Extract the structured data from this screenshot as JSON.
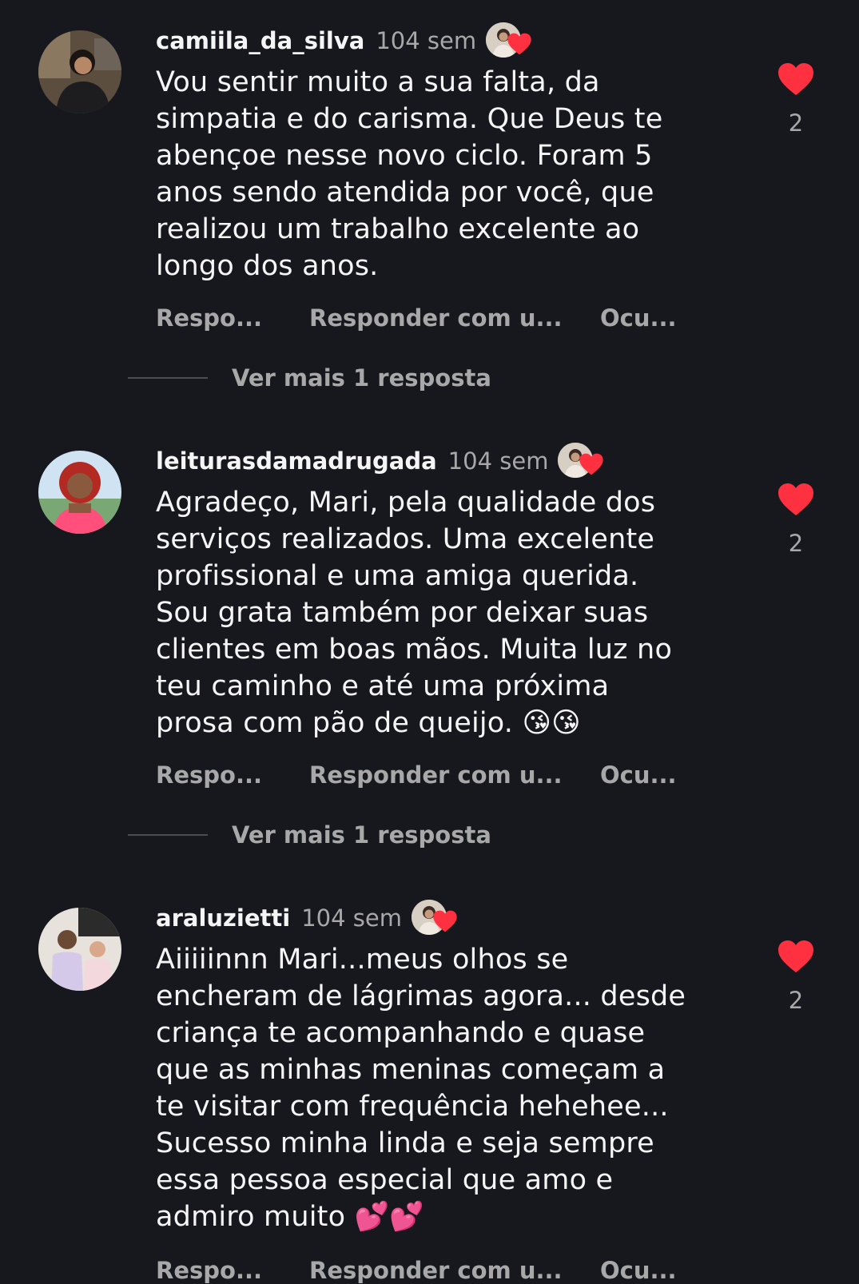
{
  "colors": {
    "background": "#16181d",
    "heart": "#ff3040",
    "muted_text": "#a8a8a8"
  },
  "actions": {
    "reply": "Respo...",
    "reply_sticker": "Responder com u...",
    "hide": "Ocu..."
  },
  "comments": [
    {
      "username": "camiila_da_silva",
      "time": "104 sem",
      "text": "Vou sentir muito a sua falta, da\nsimpatia e do carisma. Que Deus te\nabençoe nesse novo ciclo. Foram 5\nanos sendo atendida por você, que\nrealizou um trabalho excelente ao\nlongo dos anos.",
      "likes": "2",
      "liked_by_author": true,
      "more_replies": "Ver mais 1 resposta",
      "avatar_icon": "user-photo-icon"
    },
    {
      "username": "leiturasdamadrugada",
      "time": "104 sem",
      "text": "Agradeço, Mari, pela qualidade dos\nserviços realizados. Uma excelente\nprofissional e uma amiga querida.\nSou grata também por deixar suas\nclientes em boas mãos. Muita luz no\nteu caminho e até uma próxima\nprosa com pão de queijo. 😘😘",
      "likes": "2",
      "liked_by_author": true,
      "more_replies": "Ver mais 1 resposta",
      "avatar_icon": "user-photo-icon"
    },
    {
      "username": "araluzietti",
      "time": "104 sem",
      "text": "Aiiiiinnn Mari...meus olhos se\nencheram de lágrimas agora... desde\ncriança te acompanhando e quase\nque as minhas meninas começam a\nte visitar com frequência hehehee...\nSucesso minha linda e seja sempre\nessa pessoa especial que amo e\nadmiro muito 💕💕",
      "likes": "2",
      "liked_by_author": true,
      "avatar_icon": "user-photo-icon"
    }
  ]
}
